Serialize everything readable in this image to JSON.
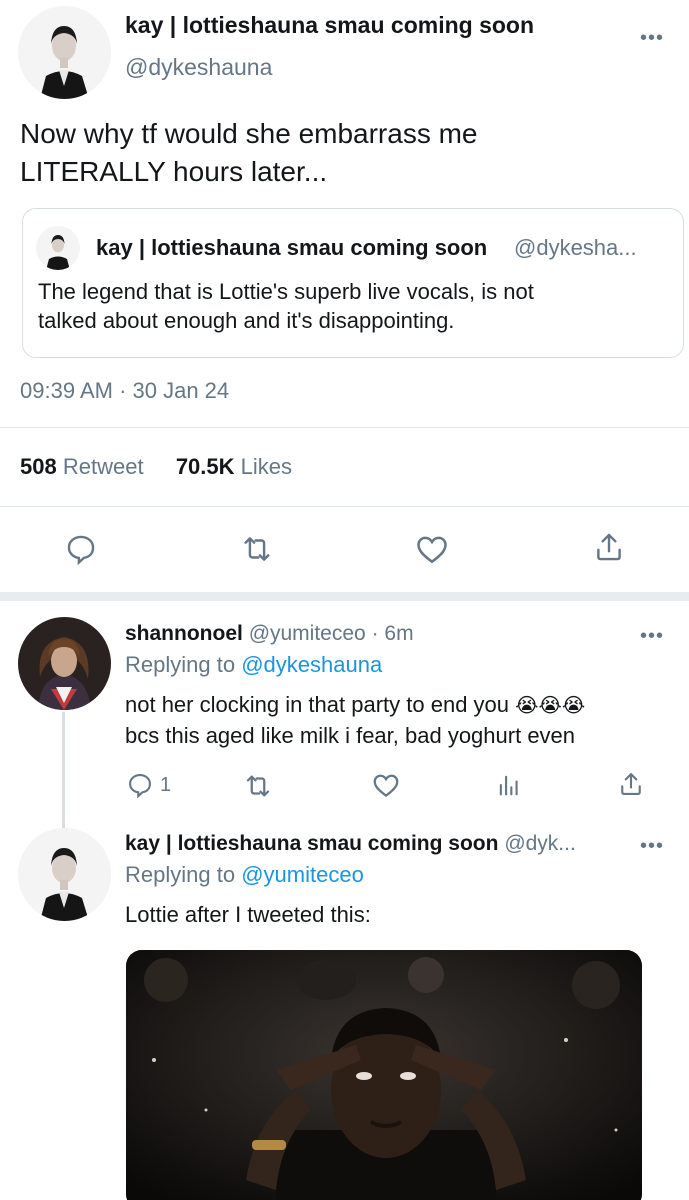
{
  "main_tweet": {
    "author_name": "kay | lottieshauna smau coming soon",
    "author_handle": "@dykeshauna",
    "text_line1": "Now why tf would she embarrass me",
    "text_line2": "LITERALLY hours later...",
    "quoted": {
      "author_name": "kay | lottieshauna smau coming soon",
      "author_handle": "@dykesha...",
      "text_line1": "The legend that is Lottie's superb live vocals, is not",
      "text_line2": "talked about enough and it's disappointing."
    },
    "timestamp": "09:39 AM · 30 Jan 24",
    "stats": {
      "retweet_count": "508",
      "retweet_label": "Retweet",
      "like_count": "70.5K",
      "like_label": "Likes"
    },
    "more_label": "•••"
  },
  "replies": [
    {
      "author_name": "shannonoel",
      "author_handle": "@yumiteceo",
      "time": "· 6m",
      "replying_prefix": "Replying to",
      "replying_to": "@dykeshauna",
      "text_line1": "not her clocking in that party to end you",
      "emoji": "😭😭😭",
      "text_line2": "bcs this aged like milk i fear, bad yoghurt even",
      "reply_count": "1"
    },
    {
      "author_name": "kay | lottieshauna smau coming soon",
      "author_handle": "@dyk...",
      "replying_prefix": "Replying to",
      "replying_to": "@yumiteceo",
      "text_line1": "Lottie after I tweeted this:"
    }
  ],
  "icons": {
    "reply": "reply-icon",
    "retweet": "retweet-icon",
    "like": "like-icon",
    "share": "share-icon",
    "analytics": "analytics-icon"
  },
  "colors": {
    "link_blue": "#1b95e0",
    "secondary_gray": "#657786",
    "divider": "#e1e8ed"
  }
}
